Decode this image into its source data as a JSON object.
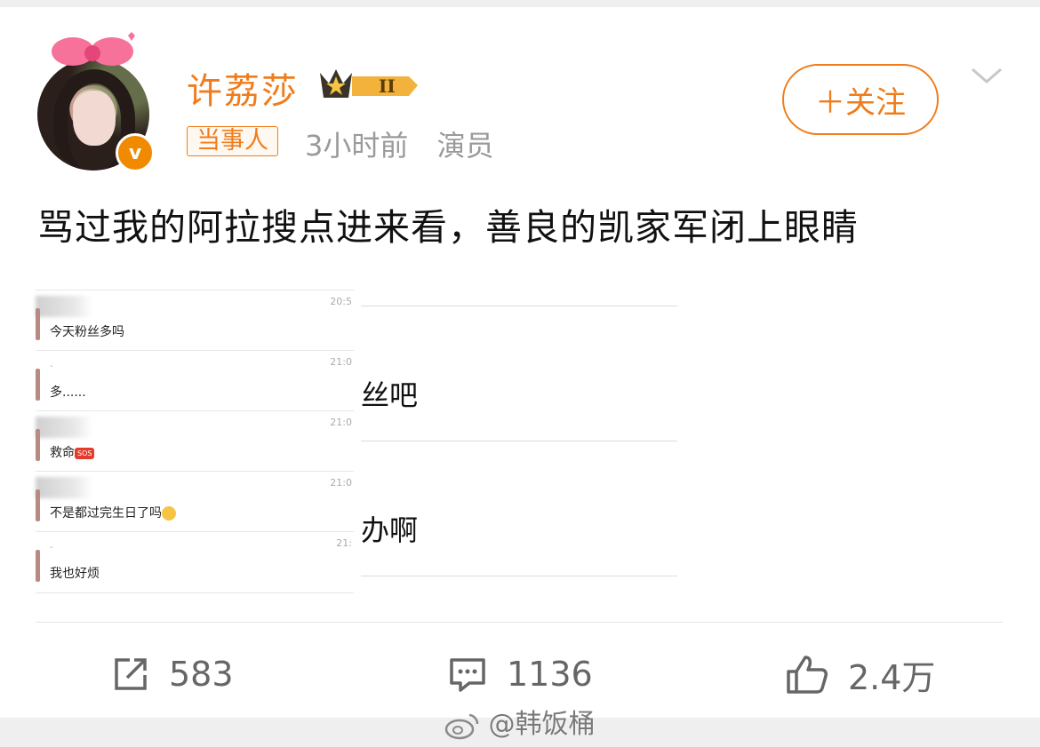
{
  "post": {
    "author": "许荔莎",
    "level_badge": "II",
    "tag": "当事人",
    "time": "3小时前",
    "role": "演员",
    "follow_label": "＋关注",
    "text": "骂过我的阿拉搜点进来看，善良的凯家军闭上眼睛"
  },
  "chat": {
    "rows": [
      {
        "time": "20:5",
        "message": "今天粉丝多吗"
      },
      {
        "time": "21:0",
        "message": "多......"
      },
      {
        "time": "21:0",
        "message": "救命",
        "emoji": "SOS"
      },
      {
        "time": "21:0",
        "message": "不是都过完生日了吗"
      },
      {
        "time": "21:",
        "message": "我也好烦"
      }
    ],
    "fragments": [
      "丝吧",
      "办啊"
    ]
  },
  "actions": {
    "repost_count": "583",
    "comment_count": "1136",
    "like_count": "2.4万"
  },
  "watermark": "@韩饭桶",
  "colors": {
    "accent": "#f07c1b",
    "muted": "#9a9a9a"
  }
}
